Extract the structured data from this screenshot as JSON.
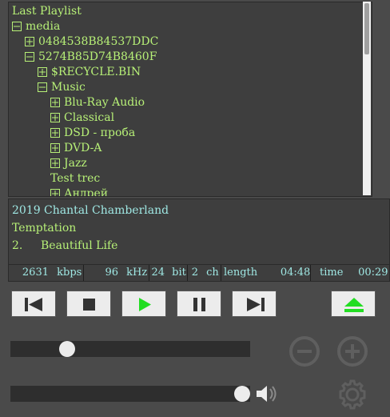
{
  "playlist": {
    "root_label": "Last Playlist",
    "items": [
      {
        "label": "media",
        "toggle": "minus"
      },
      {
        "label": "0484538B84537DDC",
        "toggle": "plus"
      },
      {
        "label": "5274B85D74B8460F",
        "toggle": "minus"
      },
      {
        "label": "$RECYCLE.BIN",
        "toggle": "plus"
      },
      {
        "label": "Music",
        "toggle": "minus"
      },
      {
        "label": "Blu-Ray Audio",
        "toggle": "plus"
      },
      {
        "label": "Classical",
        "toggle": "plus"
      },
      {
        "label": "DSD - проба",
        "toggle": "plus"
      },
      {
        "label": "DVD-A",
        "toggle": "plus"
      },
      {
        "label": "Jazz",
        "toggle": "plus"
      },
      {
        "label": "Test trec",
        "toggle": "none"
      },
      {
        "label": "Андрей",
        "toggle": "plus"
      }
    ]
  },
  "now_playing": {
    "year": "2019",
    "artist": "Chantal Chamberland",
    "album": "Temptation",
    "track_number": "2.",
    "track_title": "Beautiful Life"
  },
  "status": {
    "bitrate": "2631",
    "bitrate_unit": "kbps",
    "sample_rate": "96",
    "sample_rate_unit": "kHz",
    "bit_depth": "24",
    "bit_depth_unit": "bit",
    "channels": "2",
    "channels_unit": "ch",
    "length_label": "length",
    "length": "04:48",
    "time_label": "time",
    "time": "00:29"
  },
  "controls": {
    "buttons": [
      "previous",
      "stop",
      "play",
      "pause",
      "next",
      "eject"
    ],
    "active_color": "#22dd22",
    "icon_color": "#333333"
  },
  "sliders": {
    "position_fraction": 0.13,
    "volume_fraction": 1.0
  },
  "colors": {
    "tree_text": "#b7f077",
    "info_accent": "#9fe8e4",
    "background": "#4a4a4a",
    "panel": "#3e3e3e"
  }
}
